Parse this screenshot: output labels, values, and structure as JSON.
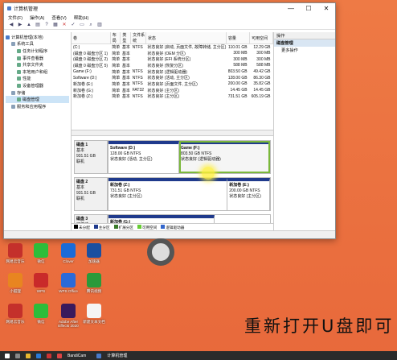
{
  "window": {
    "title": "计算机管理",
    "controls": [
      "—",
      "☐",
      "✕"
    ]
  },
  "menu": [
    "文件(F)",
    "操作(A)",
    "查看(V)",
    "帮助(H)"
  ],
  "tree": [
    {
      "label": "计算机管理(本地)",
      "indent": 0
    },
    {
      "label": "系统工具",
      "indent": 1
    },
    {
      "label": "任务计划程序",
      "indent": 2
    },
    {
      "label": "事件查看器",
      "indent": 2
    },
    {
      "label": "共享文件夹",
      "indent": 2
    },
    {
      "label": "本地用户和组",
      "indent": 2
    },
    {
      "label": "性能",
      "indent": 2
    },
    {
      "label": "设备管理器",
      "indent": 2
    },
    {
      "label": "存储",
      "indent": 1
    },
    {
      "label": "磁盘管理",
      "indent": 2,
      "selected": true
    },
    {
      "label": "服务和应用程序",
      "indent": 1
    }
  ],
  "columns": [
    "卷",
    "布局",
    "类型",
    "文件系统",
    "状态",
    "容量",
    "可用空间"
  ],
  "volumes": [
    [
      "(C:)",
      "简单",
      "基本",
      "NTFS",
      "状态良好 (启动, 页面文件, 故障转储, 主分区)",
      "110.01 GB",
      "12.29 GB"
    ],
    [
      "(磁盘 0 磁盘分区 1)",
      "简单",
      "基本",
      "",
      "状态良好 (OEM 分区)",
      "300 MB",
      "300 MB"
    ],
    [
      "(磁盘 0 磁盘分区 2)",
      "简单",
      "基本",
      "",
      "状态良好 (EFI 系统分区)",
      "300 MB",
      "300 MB"
    ],
    [
      "(磁盘 0 磁盘分区 5)",
      "简单",
      "基本",
      "",
      "状态良好 (恢复分区)",
      "588 MB",
      "588 MB"
    ],
    [
      "Game (F:)",
      "简单",
      "基本",
      "NTFS",
      "状态良好 (逻辑驱动器)",
      "803.50 GB",
      "49.42 GB"
    ],
    [
      "Software (D:)",
      "简单",
      "基本",
      "NTFS",
      "状态良好 (活动, 主分区)",
      "128.00 GB",
      "86.30 GB"
    ],
    [
      "新加卷 (E:)",
      "简单",
      "基本",
      "NTFS",
      "状态良好 (页面文件, 主分区)",
      "200.00 GB",
      "35.82 GB"
    ],
    [
      "新加卷 (G:)",
      "简单",
      "基本",
      "FAT32",
      "状态良好 (主分区)",
      "14.45 GB",
      "14.45 GB"
    ],
    [
      "新加卷 (Z:)",
      "简单",
      "基本",
      "NTFS",
      "状态良好 (主分区)",
      "731.51 GB",
      "605.19 GB"
    ]
  ],
  "disks": [
    {
      "name": "磁盘 1",
      "type": "基本",
      "size": "931.51 GB",
      "state": "联机",
      "parts": [
        {
          "name": "Software (D:)",
          "size": "128.00 GB NTFS",
          "status": "状态良好 (活动, 主分区)"
        },
        {
          "name": "Game (F:)",
          "size": "803.50 GB NTFS",
          "status": "状态良好 (逻辑驱动器)",
          "selected": true
        }
      ]
    },
    {
      "name": "磁盘 2",
      "type": "基本",
      "size": "931.51 GB",
      "state": "联机",
      "parts": [
        {
          "name": "新加卷 (Z:)",
          "size": "731.51 GB NTFS",
          "status": "状态良好 (主分区)"
        },
        {
          "name": "新加卷 (E:)",
          "size": "200.00 GB NTFS",
          "status": "状态良好 (主分区)"
        }
      ]
    },
    {
      "name": "磁盘 3",
      "type": "可移动",
      "size": "",
      "state": "",
      "parts": [
        {
          "name": "新加卷 (G:)",
          "size": "",
          "status": ""
        }
      ]
    }
  ],
  "legend": [
    {
      "label": "未分配",
      "color": "#000000"
    },
    {
      "label": "主分区",
      "color": "#1f3a8c"
    },
    {
      "label": "扩展分区",
      "color": "#3a7a2a"
    },
    {
      "label": "可用空间",
      "color": "#66cc33"
    },
    {
      "label": "逻辑驱动器",
      "color": "#3366cc"
    }
  ],
  "actions": {
    "header": "操作",
    "items": [
      "磁盘管理",
      "更多操作"
    ]
  },
  "desktop_icons": [
    {
      "label": "网易云音乐",
      "color": "#c4302b"
    },
    {
      "label": "微信",
      "color": "#2dbd3a"
    },
    {
      "label": "Clover",
      "color": "#1a6bd8"
    },
    {
      "label": "加速器",
      "color": "#1a4fa0"
    },
    {
      "label": "小狐狸",
      "color": "#e88520"
    },
    {
      "label": "WPS",
      "color": "#c92a2a"
    },
    {
      "label": "WPS Office",
      "color": "#2b6ad8"
    },
    {
      "label": "腾讯视频",
      "color": "#2a9a3a"
    },
    {
      "label": "网易云音乐",
      "color": "#c4302b"
    },
    {
      "label": "微信",
      "color": "#2dbd3a"
    },
    {
      "label": "Adobe After Effects 2020",
      "color": "#3a1a5c"
    },
    {
      "label": "新建文本文档",
      "color": "#f5f5f5"
    }
  ],
  "subtitle": "重新打开U盘即可",
  "taskbar": {
    "app1": "BandiCam",
    "app2": "计算机管理"
  }
}
